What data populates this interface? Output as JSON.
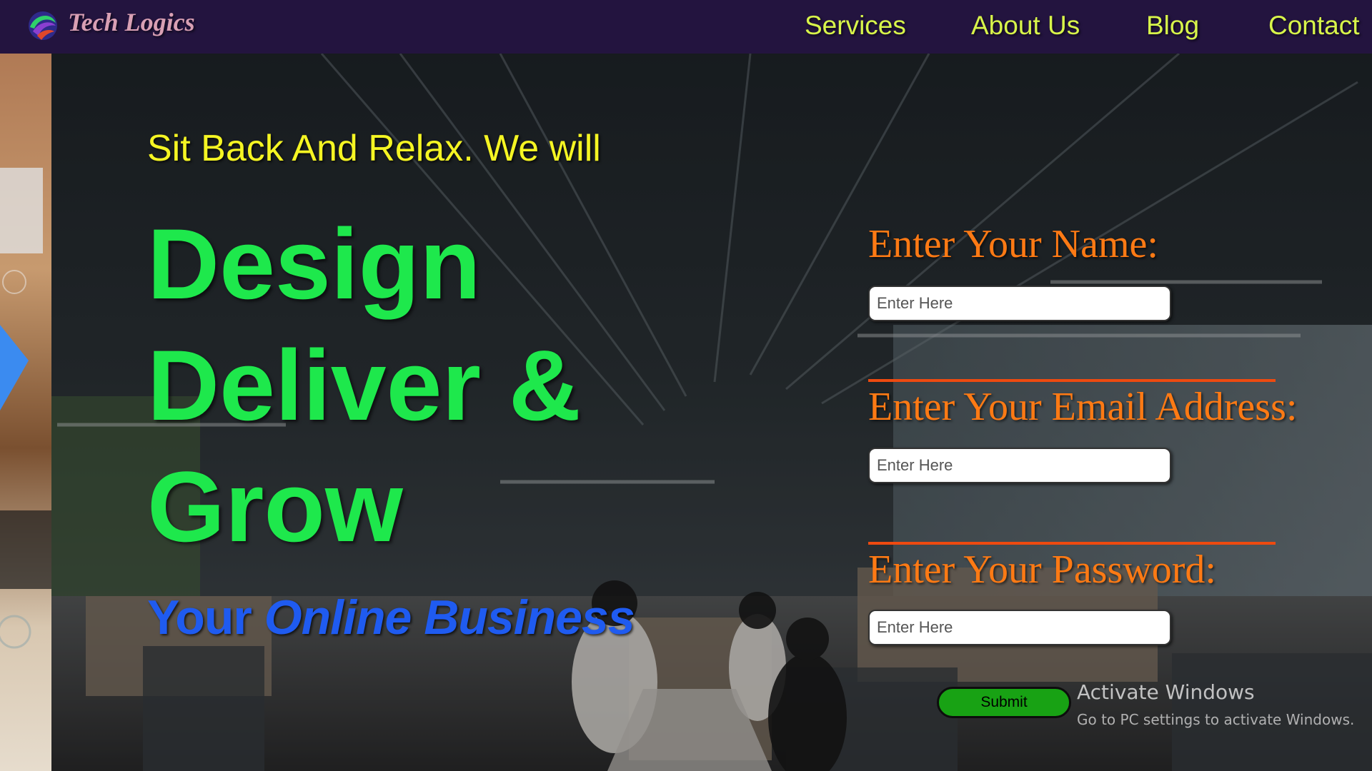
{
  "brand": {
    "name": "Tech Logics",
    "logo_icon": "bird-logo-icon"
  },
  "nav": {
    "items": [
      {
        "label": "Services"
      },
      {
        "label": "About Us"
      },
      {
        "label": "Blog"
      },
      {
        "label": "Contact"
      }
    ]
  },
  "hero": {
    "tagline": "Sit Back And Relax. We will",
    "headline": [
      "Design",
      "Deliver &",
      "Grow"
    ],
    "sub_normal": "Your ",
    "sub_emphasis": "Online Business"
  },
  "form": {
    "fields": [
      {
        "label": "Enter Your Name:",
        "placeholder": "Enter Here",
        "value": ""
      },
      {
        "label": "Enter Your Email Address:",
        "placeholder": "Enter Here",
        "value": ""
      },
      {
        "label": "Enter Your Password:",
        "placeholder": "Enter Here",
        "value": ""
      }
    ],
    "submit_label": "Submit"
  },
  "watermark": {
    "title": "Activate Windows",
    "subtitle": "Go to PC settings to activate Windows."
  },
  "colors": {
    "navbar": "#23143f",
    "nav_text": "#d8f54a",
    "tagline": "#f5f523",
    "headline": "#1ee84c",
    "sub": "#1f5bf0",
    "form_label": "#ff7a14",
    "divider": "#ee4a10",
    "submit": "#18a214"
  }
}
